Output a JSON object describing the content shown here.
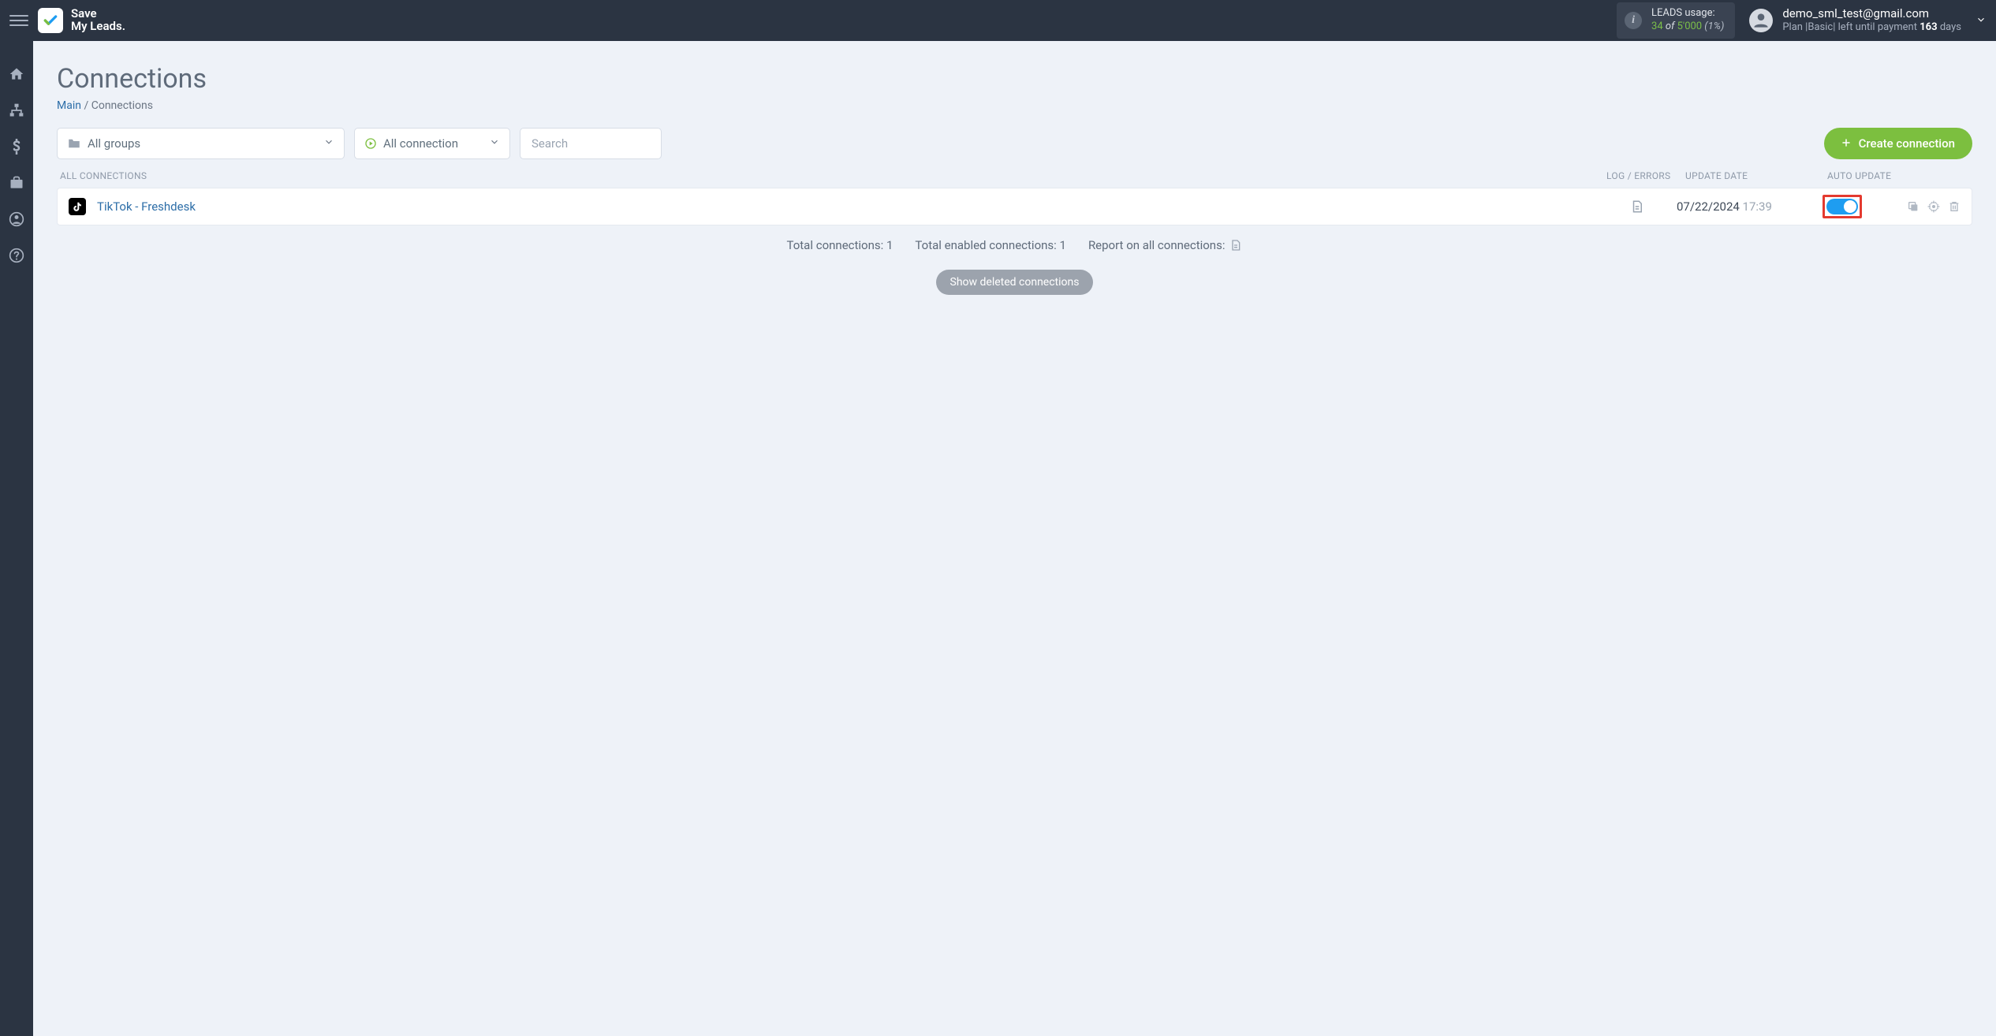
{
  "header": {
    "logo_line1": "Save",
    "logo_line2": "My Leads.",
    "leads_label": "LEADS usage:",
    "leads_used": "34",
    "leads_of": " of ",
    "leads_total": "5'000",
    "leads_pct": " (1%)",
    "user_email": "demo_sml_test@gmail.com",
    "plan_prefix": "Plan |",
    "plan_name": "Basic",
    "plan_mid": "| left until payment ",
    "plan_days": "163",
    "plan_suffix": " days"
  },
  "page": {
    "title": "Connections",
    "bc_main": "Main",
    "bc_sep": "  /  ",
    "bc_current": "Connections"
  },
  "filters": {
    "groups_label": "All groups",
    "conn_label": "All connection",
    "search_placeholder": "Search",
    "create_label": "Create connection"
  },
  "columns": {
    "name": "ALL CONNECTIONS",
    "log": "LOG / ERRORS",
    "date": "UPDATE DATE",
    "auto": "AUTO UPDATE"
  },
  "rows": [
    {
      "name": "TikTok - Freshdesk",
      "date": "07/22/2024",
      "time": " 17:39"
    }
  ],
  "totals": {
    "t1": "Total connections: 1",
    "t2": "Total enabled connections: 1",
    "t3": "Report on all connections:"
  },
  "show_deleted": "Show deleted connections"
}
